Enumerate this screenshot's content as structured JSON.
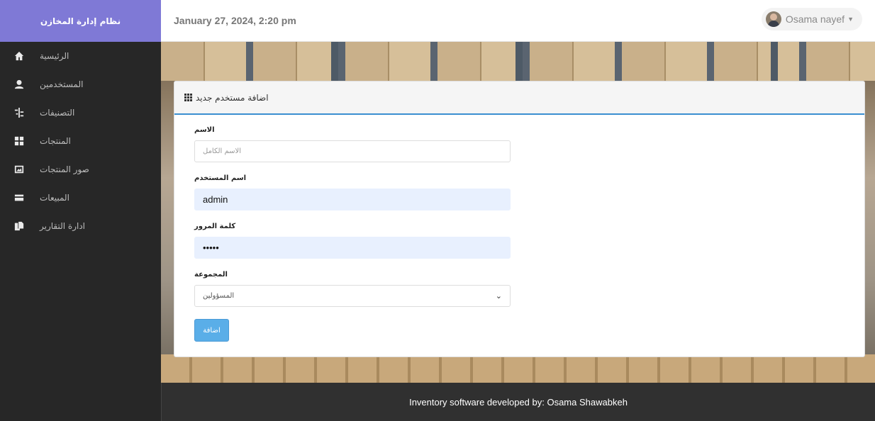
{
  "sidebar": {
    "brand": "نظام إدارة المخازن",
    "items": [
      {
        "label": "الرئيسية",
        "icon": "home-icon"
      },
      {
        "label": "المستخدمين",
        "icon": "user-icon"
      },
      {
        "label": "التصنيفات",
        "icon": "categories-icon"
      },
      {
        "label": "المنتجات",
        "icon": "grid-icon"
      },
      {
        "label": "صور المنتجات",
        "icon": "picture-icon"
      },
      {
        "label": "المبيعات",
        "icon": "credit-card-icon"
      },
      {
        "label": "ادارة التقارير",
        "icon": "reports-icon"
      }
    ]
  },
  "header": {
    "date": "January 27, 2024, 2:20 pm",
    "user_name": "Osama nayef"
  },
  "panel": {
    "title": "اضافة مستخدم جديد",
    "fields": {
      "name_label": "الاسم",
      "name_placeholder": "الاسم الكامل",
      "username_label": "اسم المستخدم",
      "username_value": "admin",
      "password_label": "كلمة المرور",
      "password_value": "•••••",
      "group_label": "المجموعة",
      "group_value": "المسؤولين"
    },
    "submit_label": "اضافة"
  },
  "footer": {
    "text": "Inventory software developed by: Osama Shawabkeh"
  },
  "colors": {
    "brand": "#7f79d6",
    "sidebar_bg": "#272727",
    "accent": "#3b8fd0",
    "button": "#5aaee8"
  }
}
